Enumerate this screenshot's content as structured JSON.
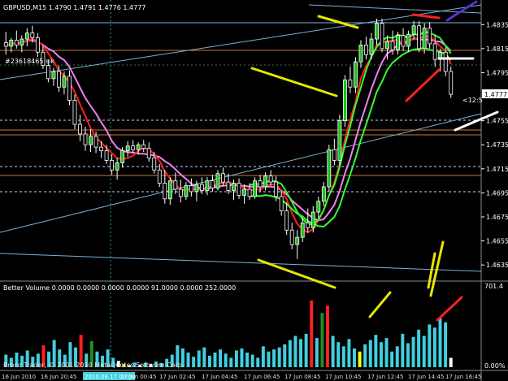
{
  "chart_header": {
    "text": "GBPUSD,M15  1.4790 1.4791 1.4776 1.4777"
  },
  "indicator_header": {
    "text": "Better Volume 0.0000 0.0000 0.0000 0.0000 91.0000 0.0000 252.0000"
  },
  "account_label": "#23618465 sik",
  "copyright": "Broco Trader, © 2001-2010 MetaQuotes Software Corp.",
  "current_price": "1.4777",
  "arrow_label": "<12:5",
  "volume_axis": {
    "max": "701.4",
    "min": "0.00%"
  },
  "colors": {
    "background": "#000000",
    "bull_candle": "#1fbf1f",
    "bear_candle": "#000000",
    "candle_outline": "#ffffff",
    "ma_fast": "#ff2020",
    "ma_slow": "#ee82ee",
    "ma_green": "#33ff33",
    "volume_normal": "#40d0e0",
    "volume_climax": "#ff2020",
    "volume_churn": "#1f8f1f",
    "volume_low": "#ffffff",
    "volume_highlight": "#ffff00",
    "grid_orange": "#c8783c",
    "grid_blue": "#7fb0d0"
  },
  "chart_data": {
    "type": "candlestick",
    "symbol": "GBPUSD",
    "timeframe": "M15",
    "y_ticks": [
      "1.4835",
      "1.4815",
      "1.4795",
      "1.4777",
      "1.4755",
      "1.4735",
      "1.4715",
      "1.4695",
      "1.4675",
      "1.4655",
      "1.4635"
    ],
    "x_ticks": [
      "16 Jun 2010",
      "16 Jun 20:45",
      "2010.06.17 00:00",
      "17 Jun 00:45",
      "17 Jun 02:45",
      "17 Jun 04:45",
      "17 Jun 06:45",
      "17 Jun 08:45",
      "17 Jun 10:45",
      "17 Jun 12:45",
      "17 Jun 14:45",
      "17 Jun 16:45"
    ],
    "ylim": [
      1.4627,
      1.4846
    ],
    "candles": [
      [
        1.482,
        1.4829,
        1.481,
        1.4817
      ],
      [
        1.4817,
        1.4824,
        1.4812,
        1.4822
      ],
      [
        1.4822,
        1.483,
        1.4815,
        1.4818
      ],
      [
        1.4818,
        1.4826,
        1.4812,
        1.4823
      ],
      [
        1.4823,
        1.4832,
        1.4817,
        1.4828
      ],
      [
        1.4828,
        1.4834,
        1.482,
        1.4824
      ],
      [
        1.4824,
        1.4828,
        1.4808,
        1.4812
      ],
      [
        1.4812,
        1.4818,
        1.4798,
        1.4801
      ],
      [
        1.4801,
        1.4806,
        1.4787,
        1.479
      ],
      [
        1.479,
        1.4799,
        1.4784,
        1.4796
      ],
      [
        1.4796,
        1.4801,
        1.4779,
        1.4783
      ],
      [
        1.4783,
        1.4796,
        1.4777,
        1.4792
      ],
      [
        1.4792,
        1.4797,
        1.4768,
        1.4772
      ],
      [
        1.4772,
        1.4777,
        1.4748,
        1.4752
      ],
      [
        1.4752,
        1.476,
        1.4738,
        1.4744
      ],
      [
        1.4744,
        1.475,
        1.473,
        1.4735
      ],
      [
        1.4735,
        1.4748,
        1.4729,
        1.4742
      ],
      [
        1.4742,
        1.4746,
        1.4728,
        1.4733
      ],
      [
        1.4733,
        1.4738,
        1.4724,
        1.473
      ],
      [
        1.473,
        1.4735,
        1.4719,
        1.4722
      ],
      [
        1.4722,
        1.4727,
        1.471,
        1.4714
      ],
      [
        1.4714,
        1.4724,
        1.4706,
        1.472
      ],
      [
        1.472,
        1.4733,
        1.4716,
        1.473
      ],
      [
        1.473,
        1.4738,
        1.4725,
        1.4734
      ],
      [
        1.4734,
        1.4739,
        1.4728,
        1.4731
      ],
      [
        1.4731,
        1.4737,
        1.4727,
        1.4735
      ],
      [
        1.4735,
        1.4739,
        1.4729,
        1.4732
      ],
      [
        1.4732,
        1.4737,
        1.4721,
        1.4724
      ],
      [
        1.4724,
        1.4729,
        1.4711,
        1.4714
      ],
      [
        1.4714,
        1.4719,
        1.47,
        1.4703
      ],
      [
        1.4703,
        1.4714,
        1.4686,
        1.469
      ],
      [
        1.469,
        1.4708,
        1.4685,
        1.4705
      ],
      [
        1.4705,
        1.4712,
        1.4694,
        1.4698
      ],
      [
        1.4698,
        1.4706,
        1.4687,
        1.4692
      ],
      [
        1.4692,
        1.4704,
        1.4689,
        1.4701
      ],
      [
        1.4701,
        1.4707,
        1.4692,
        1.4696
      ],
      [
        1.4696,
        1.4705,
        1.4688,
        1.4702
      ],
      [
        1.4702,
        1.4708,
        1.4694,
        1.4697
      ],
      [
        1.4697,
        1.4708,
        1.4693,
        1.4705
      ],
      [
        1.4705,
        1.471,
        1.4696,
        1.4699
      ],
      [
        1.4699,
        1.4714,
        1.4697,
        1.4711
      ],
      [
        1.4711,
        1.4716,
        1.4701,
        1.4704
      ],
      [
        1.4704,
        1.4711,
        1.4694,
        1.4697
      ],
      [
        1.4697,
        1.4706,
        1.4689,
        1.4703
      ],
      [
        1.4703,
        1.4707,
        1.469,
        1.4693
      ],
      [
        1.4693,
        1.4702,
        1.4686,
        1.4698
      ],
      [
        1.4698,
        1.4703,
        1.4689,
        1.4692
      ],
      [
        1.4692,
        1.4708,
        1.469,
        1.4705
      ],
      [
        1.4705,
        1.471,
        1.4696,
        1.47
      ],
      [
        1.47,
        1.4712,
        1.4697,
        1.4709
      ],
      [
        1.4709,
        1.4714,
        1.4701,
        1.4704
      ],
      [
        1.4704,
        1.4709,
        1.4688,
        1.4692
      ],
      [
        1.4692,
        1.4697,
        1.4676,
        1.468
      ],
      [
        1.468,
        1.4687,
        1.466,
        1.4664
      ],
      [
        1.4664,
        1.467,
        1.4648,
        1.4652
      ],
      [
        1.4652,
        1.4664,
        1.464,
        1.4658
      ],
      [
        1.4658,
        1.4674,
        1.4654,
        1.467
      ],
      [
        1.467,
        1.4682,
        1.4662,
        1.4666
      ],
      [
        1.4666,
        1.4684,
        1.4662,
        1.4679
      ],
      [
        1.4679,
        1.4692,
        1.4674,
        1.4688
      ],
      [
        1.4688,
        1.4704,
        1.4684,
        1.47
      ],
      [
        1.47,
        1.4735,
        1.4696,
        1.4731
      ],
      [
        1.4731,
        1.474,
        1.4718,
        1.4722
      ],
      [
        1.4722,
        1.476,
        1.4718,
        1.4755
      ],
      [
        1.4755,
        1.4793,
        1.475,
        1.4789
      ],
      [
        1.4789,
        1.48,
        1.4778,
        1.4783
      ],
      [
        1.4783,
        1.4808,
        1.4778,
        1.4804
      ],
      [
        1.4804,
        1.4822,
        1.4799,
        1.4818
      ],
      [
        1.4818,
        1.4825,
        1.4806,
        1.481
      ],
      [
        1.481,
        1.4828,
        1.4806,
        1.4823
      ],
      [
        1.4823,
        1.484,
        1.4818,
        1.4836
      ],
      [
        1.4836,
        1.484,
        1.4812,
        1.4815
      ],
      [
        1.4815,
        1.4826,
        1.4806,
        1.4821
      ],
      [
        1.4821,
        1.483,
        1.481,
        1.4814
      ],
      [
        1.4814,
        1.4829,
        1.481,
        1.4826
      ],
      [
        1.4826,
        1.4832,
        1.4813,
        1.4817
      ],
      [
        1.4817,
        1.483,
        1.4812,
        1.4827
      ],
      [
        1.4827,
        1.4838,
        1.4822,
        1.4834
      ],
      [
        1.4834,
        1.4838,
        1.4812,
        1.4815
      ],
      [
        1.4815,
        1.4836,
        1.4811,
        1.4832
      ],
      [
        1.4832,
        1.4837,
        1.4815,
        1.4819
      ],
      [
        1.4819,
        1.4826,
        1.48,
        1.4806
      ],
      [
        1.4806,
        1.4815,
        1.4796,
        1.4812
      ],
      [
        1.4812,
        1.4816,
        1.4792,
        1.4796
      ],
      [
        1.4796,
        1.48,
        1.4774,
        1.4777
      ]
    ],
    "volume": {
      "max": 701.4,
      "series": [
        {
          "v": 120,
          "c": "n"
        },
        {
          "v": 90,
          "c": "n"
        },
        {
          "v": 140,
          "c": "n"
        },
        {
          "v": 110,
          "c": "n"
        },
        {
          "v": 160,
          "c": "n"
        },
        {
          "v": 100,
          "c": "n"
        },
        {
          "v": 130,
          "c": "n"
        },
        {
          "v": 210,
          "c": "r"
        },
        {
          "v": 150,
          "c": "n"
        },
        {
          "v": 260,
          "c": "n"
        },
        {
          "v": 170,
          "c": "n"
        },
        {
          "v": 120,
          "c": "n"
        },
        {
          "v": 240,
          "c": "n"
        },
        {
          "v": 190,
          "c": "n"
        },
        {
          "v": 310,
          "c": "r"
        },
        {
          "v": 130,
          "c": "n"
        },
        {
          "v": 250,
          "c": "g"
        },
        {
          "v": 150,
          "c": "n"
        },
        {
          "v": 110,
          "c": "n"
        },
        {
          "v": 170,
          "c": "n"
        },
        {
          "v": 90,
          "c": "n"
        },
        {
          "v": 60,
          "c": "w"
        },
        {
          "v": 30,
          "c": "y"
        },
        {
          "v": 20,
          "c": "w"
        },
        {
          "v": 45,
          "c": "n"
        },
        {
          "v": 25,
          "c": "w"
        },
        {
          "v": 40,
          "c": "n"
        },
        {
          "v": 30,
          "c": "w"
        },
        {
          "v": 55,
          "c": "n"
        },
        {
          "v": 40,
          "c": "n"
        },
        {
          "v": 80,
          "c": "n"
        },
        {
          "v": 120,
          "c": "n"
        },
        {
          "v": 210,
          "c": "n"
        },
        {
          "v": 180,
          "c": "n"
        },
        {
          "v": 140,
          "c": "n"
        },
        {
          "v": 100,
          "c": "n"
        },
        {
          "v": 160,
          "c": "n"
        },
        {
          "v": 190,
          "c": "n"
        },
        {
          "v": 110,
          "c": "n"
        },
        {
          "v": 140,
          "c": "n"
        },
        {
          "v": 170,
          "c": "n"
        },
        {
          "v": 130,
          "c": "n"
        },
        {
          "v": 90,
          "c": "n"
        },
        {
          "v": 160,
          "c": "n"
        },
        {
          "v": 180,
          "c": "n"
        },
        {
          "v": 140,
          "c": "n"
        },
        {
          "v": 120,
          "c": "n"
        },
        {
          "v": 90,
          "c": "n"
        },
        {
          "v": 200,
          "c": "n"
        },
        {
          "v": 150,
          "c": "n"
        },
        {
          "v": 170,
          "c": "n"
        },
        {
          "v": 190,
          "c": "n"
        },
        {
          "v": 220,
          "c": "n"
        },
        {
          "v": 260,
          "c": "n"
        },
        {
          "v": 300,
          "c": "n"
        },
        {
          "v": 270,
          "c": "n"
        },
        {
          "v": 320,
          "c": "n"
        },
        {
          "v": 640,
          "c": "r"
        },
        {
          "v": 280,
          "c": "n"
        },
        {
          "v": 520,
          "c": "g"
        },
        {
          "v": 590,
          "c": "r"
        },
        {
          "v": 300,
          "c": "n"
        },
        {
          "v": 240,
          "c": "n"
        },
        {
          "v": 200,
          "c": "n"
        },
        {
          "v": 270,
          "c": "n"
        },
        {
          "v": 180,
          "c": "n"
        },
        {
          "v": 150,
          "c": "y"
        },
        {
          "v": 220,
          "c": "n"
        },
        {
          "v": 260,
          "c": "n"
        },
        {
          "v": 310,
          "c": "n"
        },
        {
          "v": 240,
          "c": "n"
        },
        {
          "v": 280,
          "c": "n"
        },
        {
          "v": 150,
          "c": "n"
        },
        {
          "v": 200,
          "c": "n"
        },
        {
          "v": 320,
          "c": "n"
        },
        {
          "v": 230,
          "c": "n"
        },
        {
          "v": 290,
          "c": "n"
        },
        {
          "v": 360,
          "c": "n"
        },
        {
          "v": 300,
          "c": "n"
        },
        {
          "v": 410,
          "c": "n"
        },
        {
          "v": 380,
          "c": "n"
        },
        {
          "v": 470,
          "c": "n"
        },
        {
          "v": 430,
          "c": "n"
        },
        {
          "v": 90,
          "c": "w"
        }
      ]
    }
  }
}
